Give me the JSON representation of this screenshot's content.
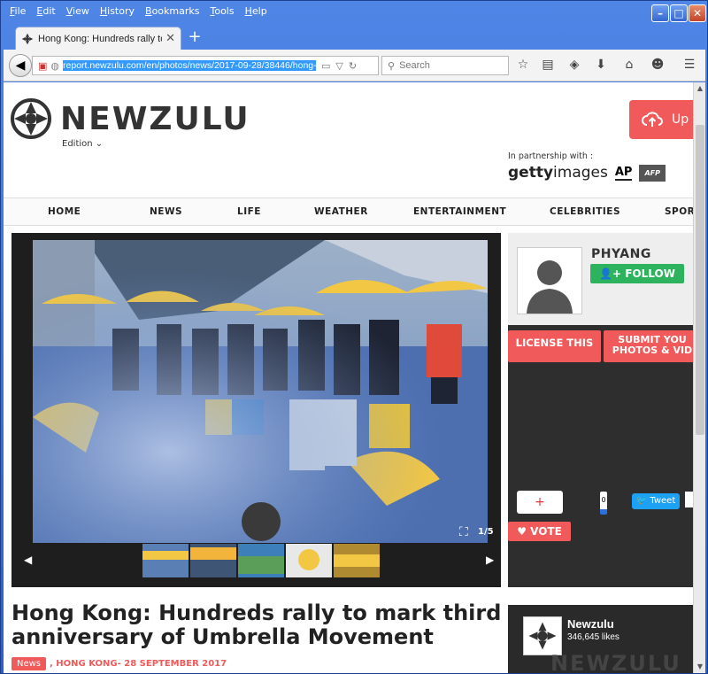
{
  "menu": [
    "File",
    "Edit",
    "View",
    "History",
    "Bookmarks",
    "Tools",
    "Help"
  ],
  "tab": {
    "title": "Hong Kong: Hundreds rally to..."
  },
  "url": "report.newzulu.com/en/photos/news/2017-09-28/38446/hong-kong",
  "search": {
    "placeholder": "Search"
  },
  "site": {
    "brand": "NEWZULU",
    "edition": "Edition",
    "upload_label": "Up",
    "partnership": "In partnership with :",
    "partners": {
      "getty_a": "getty",
      "getty_b": "images",
      "ap": "AP",
      "afp": "AFP"
    }
  },
  "nav": [
    "HOME",
    "NEWS",
    "LIFE",
    "WEATHER",
    "ENTERTAINMENT",
    "CELEBRITIES",
    "SPOR"
  ],
  "gallery": {
    "counter": "1/5",
    "watermark": "NEWZULU"
  },
  "author": {
    "name": "PHYANG",
    "follow": "FOLLOW"
  },
  "actions": {
    "license": "LICENSE THIS",
    "submit_line1": "SUBMIT YOU",
    "submit_line2": "PHOTOS & VID",
    "plus": "+",
    "count": "0",
    "tweet": "Tweet",
    "vote": "VOTE"
  },
  "article": {
    "headline": "Hong Kong: Hundreds rally to mark third anniversary of Umbrella Movement",
    "category": "News",
    "location": ", HONG KONG",
    "date": " - 28 SEPTEMBER 2017"
  },
  "fb": {
    "name": "Newzulu",
    "likes": "346,645 likes",
    "banner": "NEWZULU"
  },
  "colors": {
    "accent": "#f05a5a",
    "follow": "#2db35d",
    "tweet": "#1da1f2"
  }
}
